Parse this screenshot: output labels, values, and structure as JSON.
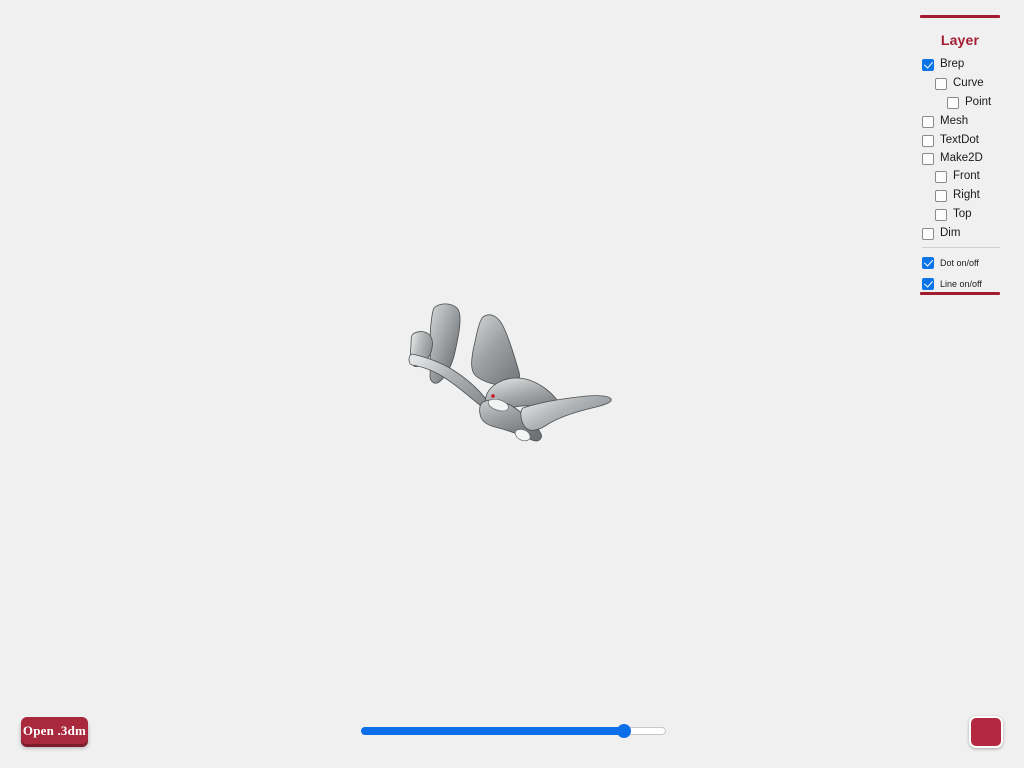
{
  "app": {
    "background_color": "#f0f0f0",
    "accent_color": "#a41c32",
    "slider_color": "#0c6ee8",
    "checkbox_checked_color": "#0a74e8"
  },
  "viewport": {
    "label": "3D model viewport",
    "model_description": "Gray shaded 3D NURBS surface model resembling curved horn and fin shapes",
    "model_color": "#9a9d9f",
    "marker_color": "#cc1122"
  },
  "layer_panel": {
    "title": "Layer",
    "items": [
      {
        "label": "Brep",
        "checked": true,
        "indent": 0
      },
      {
        "label": "Curve",
        "checked": false,
        "indent": 1
      },
      {
        "label": "Point",
        "checked": false,
        "indent": 2
      },
      {
        "label": "Mesh",
        "checked": false,
        "indent": 0
      },
      {
        "label": "TextDot",
        "checked": false,
        "indent": 0
      },
      {
        "label": "Make2D",
        "checked": false,
        "indent": 0
      },
      {
        "label": "Front",
        "checked": false,
        "indent": 1
      },
      {
        "label": "Right",
        "checked": false,
        "indent": 1
      },
      {
        "label": "Top",
        "checked": false,
        "indent": 1
      },
      {
        "label": "Dim",
        "checked": false,
        "indent": 0
      }
    ],
    "toggles": [
      {
        "label": "Dot on/off",
        "checked": true
      },
      {
        "label": "Line on/off",
        "checked": true
      }
    ]
  },
  "toolbar": {
    "open_button_label": "Open .3dm"
  },
  "slider": {
    "name": "zoom-slider",
    "value": 88,
    "min": 0,
    "max": 100
  },
  "color_swatch": {
    "name": "color-swatch",
    "color": "#b4293f"
  }
}
